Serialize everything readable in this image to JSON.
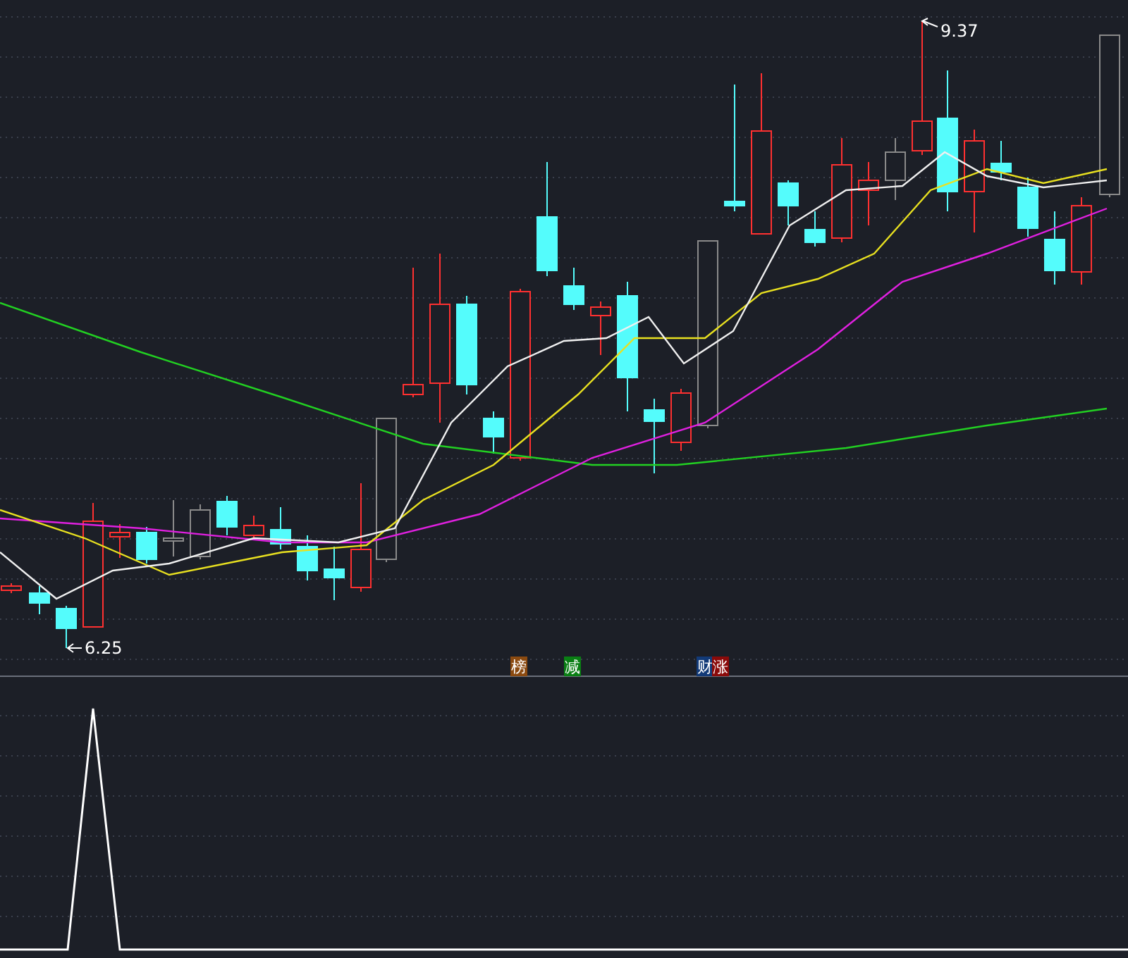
{
  "price_chart": {
    "high_label": "9.37",
    "low_label": "6.25"
  },
  "signal_badges": [
    {
      "text": "榜",
      "color": "#8b4a10"
    },
    {
      "text": "减",
      "color": "#0a7f14"
    },
    {
      "text": "财",
      "color": "#123a78"
    },
    {
      "text": "涨",
      "color": "#8a0a0a"
    }
  ]
}
